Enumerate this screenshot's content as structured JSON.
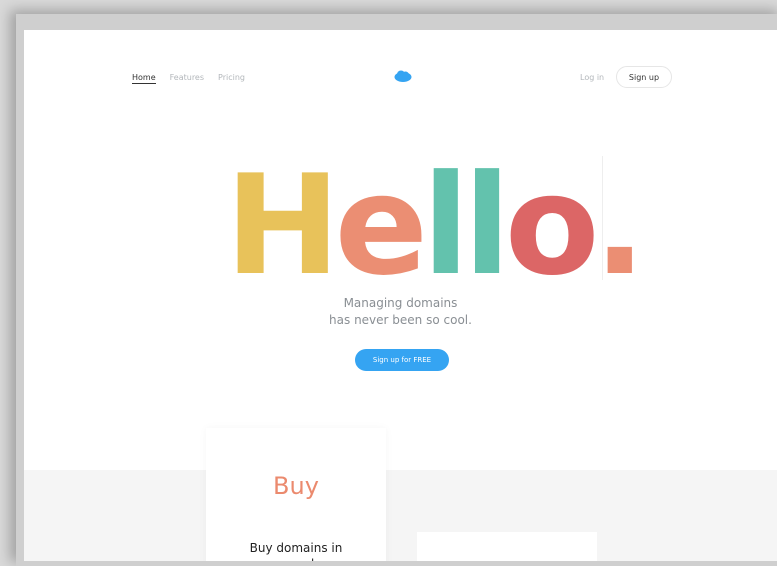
{
  "nav": {
    "items": [
      {
        "label": "Home",
        "active": true
      },
      {
        "label": "Features",
        "active": false
      },
      {
        "label": "Pricing",
        "active": false
      }
    ],
    "login_label": "Log in",
    "signup_label": "Sign up",
    "logo_icon": "cloud-icon"
  },
  "hero": {
    "word": [
      "H",
      "e",
      "l",
      "l",
      "o",
      "."
    ],
    "letter_colors": [
      "#e8c25a",
      "#eb8e73",
      "#63c2ad",
      "#63c2ad",
      "#dc6666",
      "#eb8e73"
    ],
    "tagline_line1": "Managing domains",
    "tagline_line2": "has never been so cool.",
    "cta_label": "Sign up for FREE"
  },
  "features": {
    "buy_title": "Buy",
    "buy_desc_line1": "Buy domains in",
    "buy_desc_line2": "seconds"
  },
  "colors": {
    "accent": "#35a4f2",
    "buy": "#eb8a6e"
  }
}
